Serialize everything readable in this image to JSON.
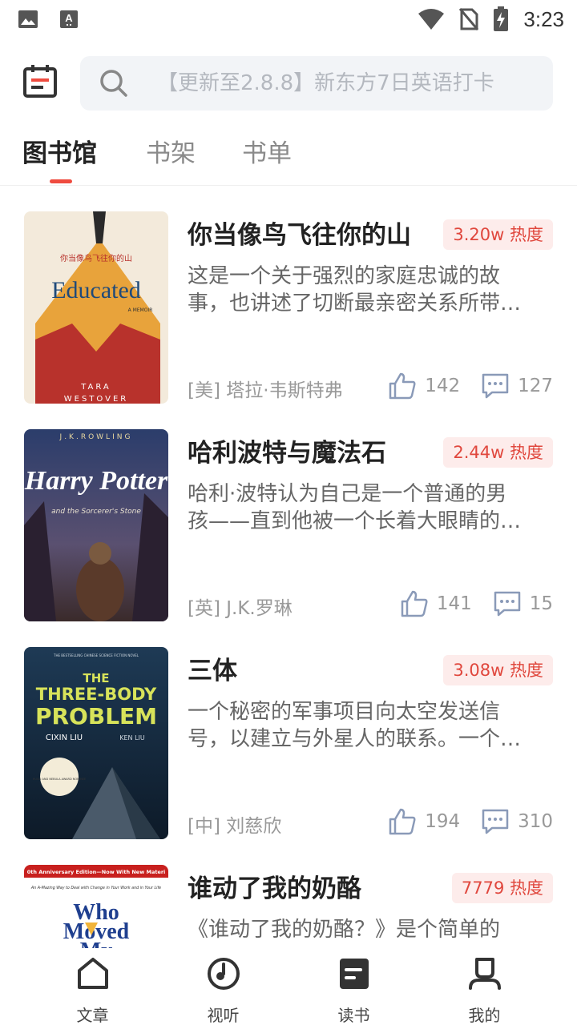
{
  "status_bar": {
    "time": "3:23"
  },
  "search": {
    "placeholder": "【更新至2.8.8】新东方7日英语打卡"
  },
  "tabs": [
    {
      "label": "图书馆",
      "active": true
    },
    {
      "label": "书架",
      "active": false
    },
    {
      "label": "书单",
      "active": false
    }
  ],
  "books": [
    {
      "title": "你当像鸟飞往你的山",
      "heat": "3.20w 热度",
      "desc_line1": "这是一个关于强烈的家庭忠诚的故",
      "desc_line2": "事，也讲述了切断最亲密关系所带…",
      "author": "[美] 塔拉·韦斯特弗",
      "likes": "142",
      "comments": "127",
      "cover": {
        "cn_title": "你当像鸟飞往你的山",
        "title": "Educated",
        "subtitle": "A MEMOIR",
        "author_line1": "TARA",
        "author_line2": "WESTOVER"
      }
    },
    {
      "title": "哈利波特与魔法石",
      "heat": "2.44w 热度",
      "desc_line1": "哈利·波特认为自己是一个普通的男",
      "desc_line2": "孩——直到他被一个长着大眼睛的…",
      "author": "[英] J.K.罗琳",
      "likes": "141",
      "comments": "15",
      "cover": {
        "author": "J.K.ROWLING",
        "title": "Harry Potter",
        "subtitle": "and the Sorcerer's Stone"
      }
    },
    {
      "title": "三体",
      "heat": "3.08w 热度",
      "desc_line1": "一个秘密的军事项目向太空发送信",
      "desc_line2": "号，以建立与外星人的联系。一个…",
      "author": "[中] 刘慈欣",
      "likes": "194",
      "comments": "310",
      "cover": {
        "tagline": "THE BESTSELLING CHINESE SCIENCE FICTION NOVEL",
        "title_line1": "THE",
        "title_line2": "THREE-BODY",
        "title_line3": "PROBLEM",
        "author": "CIXIN LIU",
        "translator": "KEN LIU",
        "award": "HUGO AND NEBULA AWARD NOMINEE"
      }
    },
    {
      "title": "谁动了我的奶酪",
      "heat": "7779 热度",
      "desc_line1": "《谁动了我的奶酪？》是个简单的",
      "cover": {
        "banner": "0th Anniversary Edition—Now With New Materi",
        "tagline": "An A-Mazing Way to Deal with Change in Your Work and in Your Life",
        "title_line1": "Who",
        "title_line2": "Moved",
        "title_line3": "My"
      }
    }
  ],
  "bottom_nav": [
    {
      "label": "文章",
      "icon": "home-icon"
    },
    {
      "label": "视听",
      "icon": "audio-disc-icon"
    },
    {
      "label": "读书",
      "icon": "book-icon",
      "active": true
    },
    {
      "label": "我的",
      "icon": "profile-icon"
    }
  ],
  "colors": {
    "accent": "#ef4b3f",
    "heat_bg": "#fdeceb",
    "heat_text": "#e0473d",
    "search_bg": "#f2f4f7"
  }
}
